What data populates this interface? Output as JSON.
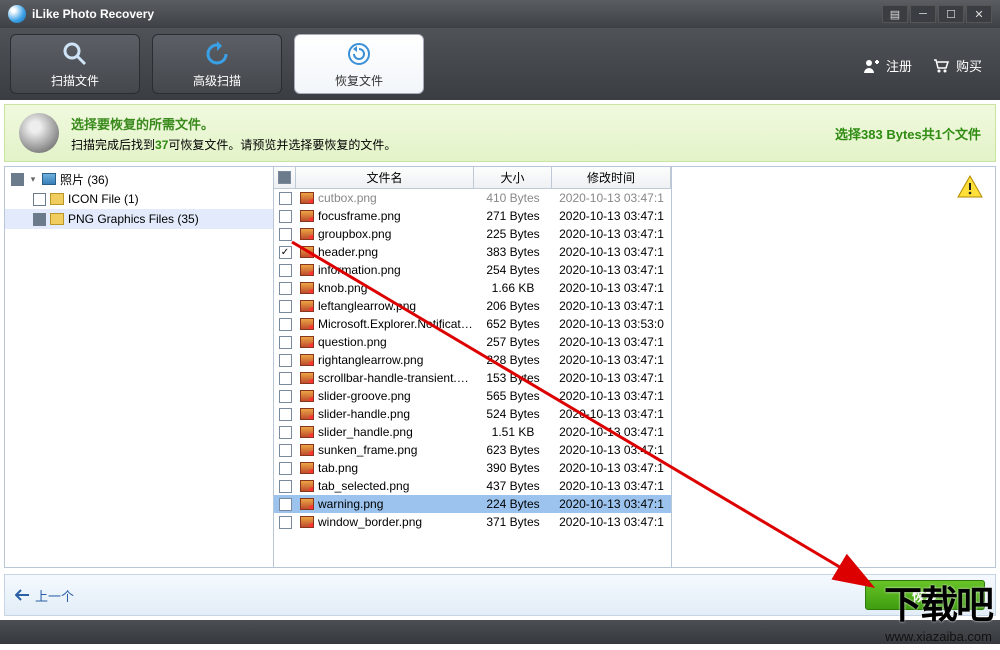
{
  "app": {
    "title": "iLike Photo Recovery"
  },
  "toolbar": {
    "scan": "扫描文件",
    "adv": "高级扫描",
    "recover": "恢复文件",
    "register": "注册",
    "buy": "购买"
  },
  "info": {
    "heading": "选择要恢复的所需文件。",
    "sub_pre": "扫描完成后找到",
    "sub_num": "37",
    "sub_post": "可恢复文件。请预览并选择要恢复的文件。",
    "summary": "选择383 Bytes共1个文件"
  },
  "tree": [
    {
      "label": "照片 (36)",
      "depth": 0,
      "state": "filled",
      "sel": false
    },
    {
      "label": "ICON File (1)",
      "depth": 1,
      "state": "empty",
      "sel": false
    },
    {
      "label": "PNG Graphics Files (35)",
      "depth": 1,
      "state": "filled",
      "sel": true
    }
  ],
  "columns": {
    "name": "文件名",
    "size": "大小",
    "date": "修改时间"
  },
  "files": [
    {
      "n": "cutbox.png",
      "s": "410 Bytes",
      "d": "2020-10-13 03:47:1",
      "chk": false,
      "cut": true
    },
    {
      "n": "focusframe.png",
      "s": "271 Bytes",
      "d": "2020-10-13 03:47:1",
      "chk": false
    },
    {
      "n": "groupbox.png",
      "s": "225 Bytes",
      "d": "2020-10-13 03:47:1",
      "chk": false
    },
    {
      "n": "header.png",
      "s": "383 Bytes",
      "d": "2020-10-13 03:47:1",
      "chk": true
    },
    {
      "n": "information.png",
      "s": "254 Bytes",
      "d": "2020-10-13 03:47:1",
      "chk": false
    },
    {
      "n": "knob.png",
      "s": "1.66 KB",
      "d": "2020-10-13 03:47:1",
      "chk": false
    },
    {
      "n": "leftanglearrow.png",
      "s": "206 Bytes",
      "d": "2020-10-13 03:47:1",
      "chk": false
    },
    {
      "n": "Microsoft.Explorer.Notificatio…",
      "s": "652 Bytes",
      "d": "2020-10-13 03:53:0",
      "chk": false
    },
    {
      "n": "question.png",
      "s": "257 Bytes",
      "d": "2020-10-13 03:47:1",
      "chk": false
    },
    {
      "n": "rightanglearrow.png",
      "s": "228 Bytes",
      "d": "2020-10-13 03:47:1",
      "chk": false
    },
    {
      "n": "scrollbar-handle-transient.png",
      "s": "153 Bytes",
      "d": "2020-10-13 03:47:1",
      "chk": false
    },
    {
      "n": "slider-groove.png",
      "s": "565 Bytes",
      "d": "2020-10-13 03:47:1",
      "chk": false
    },
    {
      "n": "slider-handle.png",
      "s": "524 Bytes",
      "d": "2020-10-13 03:47:1",
      "chk": false
    },
    {
      "n": "slider_handle.png",
      "s": "1.51 KB",
      "d": "2020-10-13 03:47:1",
      "chk": false
    },
    {
      "n": "sunken_frame.png",
      "s": "623 Bytes",
      "d": "2020-10-13 03:47:1",
      "chk": false
    },
    {
      "n": "tab.png",
      "s": "390 Bytes",
      "d": "2020-10-13 03:47:1",
      "chk": false
    },
    {
      "n": "tab_selected.png",
      "s": "437 Bytes",
      "d": "2020-10-13 03:47:1",
      "chk": false
    },
    {
      "n": "warning.png",
      "s": "224 Bytes",
      "d": "2020-10-13 03:47:1",
      "chk": false,
      "sel": true
    },
    {
      "n": "window_border.png",
      "s": "371 Bytes",
      "d": "2020-10-13 03:47:1",
      "chk": false
    }
  ],
  "bottom": {
    "prev": "上一个",
    "recover": "恢复"
  },
  "watermark": {
    "big": "下载吧",
    "url": "www.xiazaiba.com"
  }
}
